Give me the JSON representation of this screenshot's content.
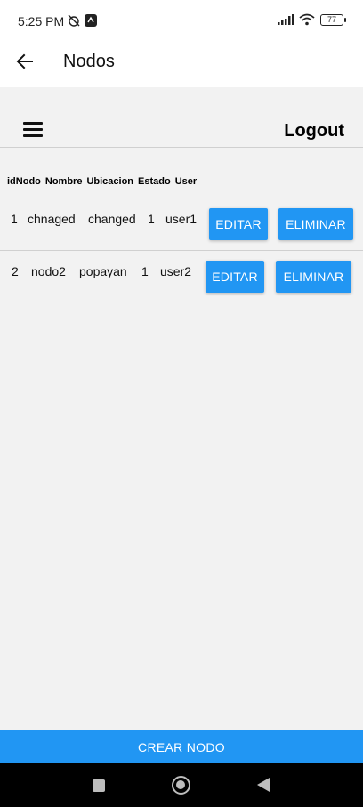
{
  "status_bar": {
    "time": "5:25 PM",
    "battery": "77"
  },
  "app_bar": {
    "title": "Nodos"
  },
  "toolbar": {
    "logout_label": "Logout"
  },
  "table": {
    "headers": [
      "idNodo",
      "Nombre",
      "Ubicacion",
      "Estado",
      "User"
    ],
    "rows": [
      {
        "id": "1",
        "nombre": "chnaged",
        "ubicacion": "changed",
        "estado": "1",
        "user": "user1"
      },
      {
        "id": "2",
        "nombre": "nodo2",
        "ubicacion": "popayan",
        "estado": "1",
        "user": "user2"
      }
    ],
    "edit_label": "EDITAR",
    "delete_label": "ELIMINAR"
  },
  "footer": {
    "create_label": "CREAR NODO"
  },
  "colors": {
    "accent": "#2196f3",
    "background": "#f2f2f2"
  },
  "icons": [
    "back-arrow-icon",
    "menu-icon",
    "square-nav-icon",
    "home-nav-icon",
    "back-nav-icon"
  ]
}
